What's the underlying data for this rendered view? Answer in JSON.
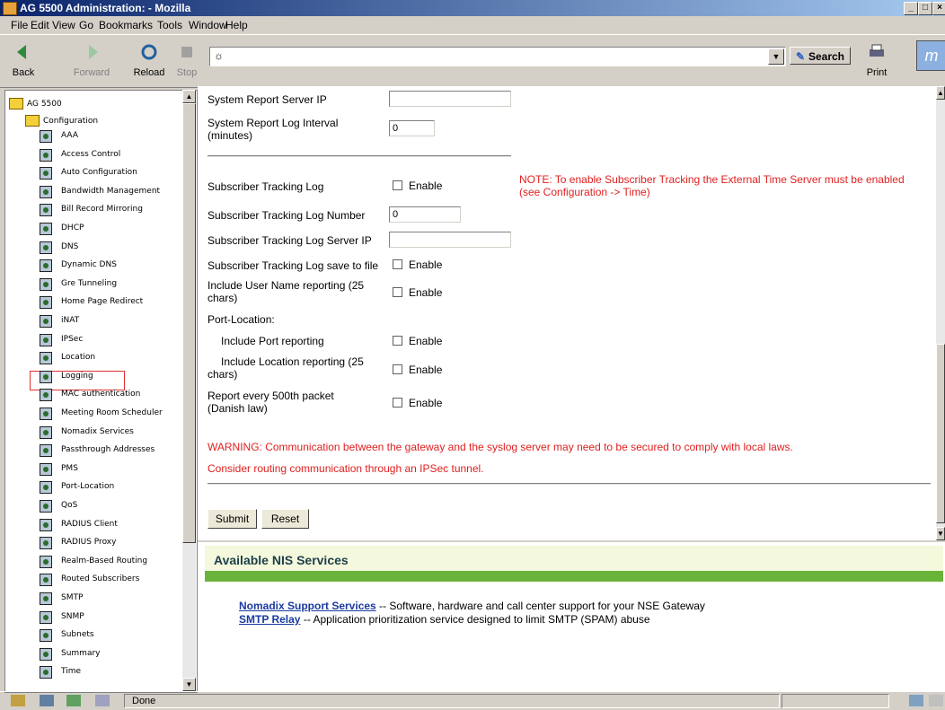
{
  "window": {
    "title": "AG 5500 Administration: - Mozilla"
  },
  "menu": [
    "File",
    "Edit",
    "View",
    "Go",
    "Bookmarks",
    "Tools",
    "Window",
    "Help"
  ],
  "toolbar": {
    "back": "Back",
    "forward": "Forward",
    "reload": "Reload",
    "stop": "Stop",
    "url": "",
    "search": "Search",
    "print": "Print"
  },
  "sidebar": {
    "root": "AG 5500",
    "config": "Configuration",
    "items": [
      "AAA",
      "Access Control",
      "Auto Configuration",
      "Bandwidth Management",
      "Bill Record Mirroring",
      "DHCP",
      "DNS",
      "Dynamic DNS",
      "Gre Tunneling",
      "Home Page Redirect",
      "iNAT",
      "IPSec",
      "Location",
      "Logging",
      "MAC authentication",
      "Meeting Room Scheduler",
      "Nomadix Services",
      "Passthrough Addresses",
      "PMS",
      "Port-Location",
      "QoS",
      "RADIUS Client",
      "RADIUS Proxy",
      "Realm-Based Routing",
      "Routed Subscribers",
      "SMTP",
      "SNMP",
      "Subnets",
      "Summary",
      "Time"
    ],
    "selected": "Logging"
  },
  "form": {
    "sys_report_ip_label": "System Report Server IP",
    "sys_report_ip_value": "",
    "sys_log_interval_label": "System Report Log Interval (minutes)",
    "sys_log_interval_value": "0",
    "sub_track_log_label": "Subscriber Tracking Log",
    "enable": "Enable",
    "note": "NOTE: To enable Subscriber Tracking the External Time Server must be enabled (see Configuration -> Time)",
    "sub_track_num_label": "Subscriber Tracking Log Number",
    "sub_track_num_value": "0",
    "sub_track_ip_label": "Subscriber Tracking Log Server IP",
    "sub_track_ip_value": "",
    "sub_track_file_label": "Subscriber Tracking Log save to file",
    "user_name_label": "Include User Name reporting (25 chars)",
    "port_location_label": "Port-Location:",
    "port_reporting_label": "Include Port reporting",
    "location_reporting_label": "Include Location reporting (25 chars)",
    "report_500_label": "Report every 500th packet (Danish law)",
    "warning1": "WARNING: Communication between the gateway and the syslog server may need to be secured to comply with local laws.",
    "warning2": "Consider routing communication through an IPSec tunnel.",
    "submit": "Submit",
    "reset": "Reset"
  },
  "nis": {
    "title": "Available NIS Services",
    "services": [
      {
        "name": "Nomadix Support Services",
        "desc": " -- Software, hardware and call center support for your NSE Gateway"
      },
      {
        "name": "SMTP Relay",
        "desc": " -- Application prioritization service designed to limit SMTP (SPAM) abuse"
      }
    ]
  },
  "status": {
    "text": "Done"
  }
}
